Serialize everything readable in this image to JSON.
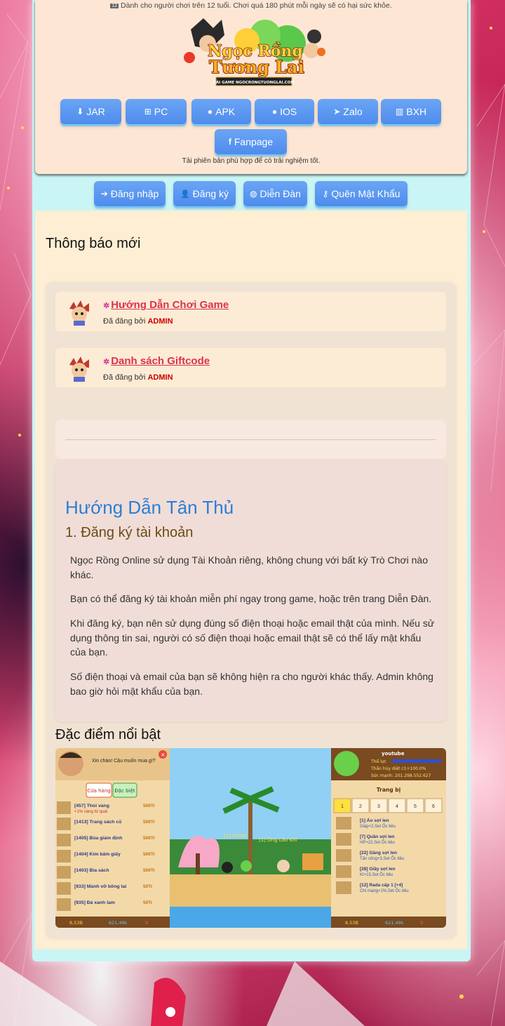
{
  "header": {
    "age_badge": "12",
    "age_notice": "Dành cho người chơi trên 12 tuổi. Chơi quá 180 phút mỗi ngày sẽ có hại sức khỏe.",
    "logo_line1": "Ngọc Rồng",
    "logo_line2": "Tương Lai",
    "logo_tag": "TẢI GAME NGOCRONGTUONGLAI.COM",
    "download_note": "Tải phiên bản phù hợp để có trải nghiệm tốt."
  },
  "downloads": [
    {
      "label": "JAR",
      "icon": "download-icon",
      "glyph": "⬇"
    },
    {
      "label": "PC",
      "icon": "windows-icon",
      "glyph": "⊞"
    },
    {
      "label": "APK",
      "icon": "android-icon",
      "glyph": "●"
    },
    {
      "label": "IOS",
      "icon": "apple-icon",
      "glyph": "●"
    },
    {
      "label": "Zalo",
      "icon": "telegram-icon",
      "glyph": "➤"
    },
    {
      "label": "BXH",
      "icon": "bar-chart-icon",
      "glyph": "▥"
    },
    {
      "label": "Fanpage",
      "icon": "facebook-icon",
      "glyph": "f"
    }
  ],
  "account_nav": [
    {
      "label": "Đăng nhập",
      "icon": "login-icon",
      "glyph": "➔"
    },
    {
      "label": "Đăng ký",
      "icon": "user-plus-icon",
      "glyph": "👤"
    },
    {
      "label": "Diễn Đàn",
      "icon": "globe-icon",
      "glyph": "◍"
    },
    {
      "label": "Quên Mật Khẩu",
      "icon": "key-icon",
      "glyph": "⚷"
    }
  ],
  "news": {
    "heading": "Thông báo mới",
    "posts": [
      {
        "title": "Hướng Dẫn Chơi Game",
        "posted_by_label": "Đã đăng bởi",
        "author": "ADMIN"
      },
      {
        "title": "Danh sách Giftcode",
        "posted_by_label": "Đã đăng bởi",
        "author": "ADMIN"
      }
    ]
  },
  "guide": {
    "title": "Hướng Dẫn Tân Thủ",
    "section": "1. Đăng ký tài khoản",
    "paragraphs": [
      "Ngọc Rồng Online sử dụng Tài Khoản riêng, không chung với bất kỳ Trò Chơi nào khác.",
      "Bạn có thể đăng ký tài khoản miễn phí ngay trong game, hoặc trên trang Diễn Đàn.",
      "Khi đăng ký, bạn nên sử dụng đúng số điện thoại hoặc email thật của mình. Nếu sử dụng thông tin sai, người có số điện thoại hoặc email thật sẽ có thể lấy mật khẩu của bạn.",
      "Số điện thoại và email của bạn sẽ không hiện ra cho người khác thấy. Admin không bao giờ hỏi mật khẩu của bạn."
    ]
  },
  "features": {
    "heading": "Đặc điểm nổi bật",
    "screenshot": {
      "shop_greeting": "Xin chào! Cậu muốn mua gì?",
      "shop_tabs": [
        "Cửa hàng",
        "Đặc biệt"
      ],
      "shop_items": [
        {
          "name": "[457] Thỏi vàng",
          "price": "500Tr"
        },
        {
          "name": "[1413] Trang sách cũ",
          "price": "500Tr"
        },
        {
          "name": "[1405] Bùa giảm định",
          "price": "500Tr"
        },
        {
          "name": "[1404] Kim bấm giấy",
          "price": "500Tr"
        },
        {
          "name": "[1403] Bìa sách",
          "price": "500Tr"
        },
        {
          "name": "[933] Mảnh vỡ bông tai",
          "price": "50Tr"
        },
        {
          "name": "[935] Đá xanh lam",
          "price": "50Tr"
        }
      ],
      "shop_item_note": "+1% vàng từ quái",
      "status_left": [
        "8,53B",
        "621,49k",
        "0"
      ],
      "player_name": "youtube",
      "player_stats": [
        "Thể lực",
        "Thần hủy diệt c1+100.0%",
        "Sức mạnh: 201.298.552.627"
      ],
      "inventory_title": "Trang bị",
      "inventory_tabs": [
        "1",
        "2",
        "3",
        "4",
        "5",
        "6"
      ],
      "inventory_items": [
        {
          "name": "[1] Áo sợi len",
          "detail": "Giáp+2,Set Ốc tiêu"
        },
        {
          "name": "[7] Quần sợi len",
          "detail": "HP+22,Set Ốc tiêu"
        },
        {
          "name": "[22] Găng sợi len",
          "detail": "Tấn công+3,Set Ốc tiêu"
        },
        {
          "name": "[28] Giầy sợi len",
          "detail": "KI+15,Set Ốc tiêu"
        },
        {
          "name": "[12] Rada cấp 1 [+4]",
          "detail": "Chí mạng+1%,Set Ốc tiêu"
        }
      ],
      "status_right": [
        "8,53B",
        "621,49k",
        "0"
      ],
      "npc_labels": [
        "[1] Santa",
        "[1] Ông Lão Khỉ"
      ]
    }
  },
  "colors": {
    "header_bg": "#fde6d4",
    "frame_bg": "#c9f5f5",
    "button_blue": "#5b97ef",
    "link_red": "#d9334f",
    "guide_title_blue": "#2a7fd6",
    "section_brown": "#6b4b14"
  }
}
